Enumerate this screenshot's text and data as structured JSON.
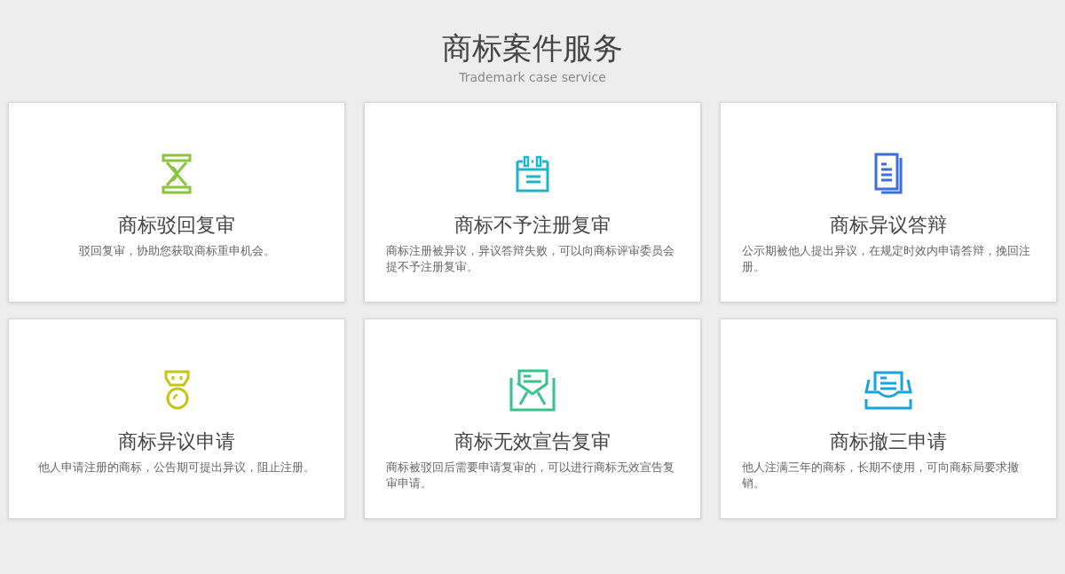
{
  "header": {
    "title": "商标案件服务",
    "subtitle": "Trademark case service"
  },
  "services": [
    {
      "kind": "hourglass",
      "color": "#8cc43f",
      "title": "商标驳回复审",
      "description": "驳回复审，协助您获取商标重申机会。"
    },
    {
      "kind": "calendar",
      "color": "#1ab6cf",
      "title": "商标不予注册复审",
      "description": "商标注册被异议，异议答辩失败，可以向商标评审委员会提不予注册复审。"
    },
    {
      "kind": "documents",
      "color": "#3a6fdc",
      "title": "商标异议答辩",
      "description": "公示期被他人提出异议，在规定时效内申请答辩，挽回注册。"
    },
    {
      "kind": "medal",
      "color": "#c6c515",
      "title": "商标异议申请",
      "description": "他人申请注册的商标，公告期可提出异议，阻止注册。"
    },
    {
      "kind": "envelope",
      "color": "#36c28c",
      "title": "商标无效宣告复审",
      "description": "商标被驳回后需要申请复审的，可以进行商标无效宣告复审申请。"
    },
    {
      "kind": "inbox",
      "color": "#17a3e0",
      "title": "商标撤三申请",
      "description": "他人注满三年的商标，长期不使用，可向商标局要求撤销。"
    }
  ]
}
